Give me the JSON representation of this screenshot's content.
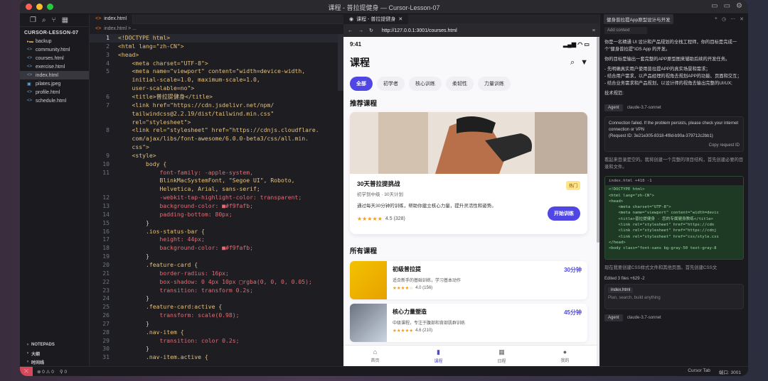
{
  "window": {
    "title": "课程 - 普拉提健身 — Cursor-Lesson-07"
  },
  "sidebar": {
    "project": "CURSOR-LESSON-07",
    "items": [
      {
        "label": "backup",
        "icon": "folder-icon"
      },
      {
        "label": "community.html",
        "icon": "html-file-icon"
      },
      {
        "label": "courses.html",
        "icon": "html-file-icon"
      },
      {
        "label": "exercise.html",
        "icon": "html-file-icon"
      },
      {
        "label": "index.html",
        "icon": "html-file-icon",
        "active": true
      },
      {
        "label": "pilates.jpeg",
        "icon": "image-file-icon"
      },
      {
        "label": "profile.html",
        "icon": "html-file-icon"
      },
      {
        "label": "schedule.html",
        "icon": "html-file-icon"
      }
    ],
    "bottom": [
      "NOTEPADS",
      "大纲",
      "时间线"
    ]
  },
  "editor": {
    "tab": "index.html",
    "breadcrumb": "index.html > ...",
    "lines": [
      {
        "n": "1",
        "t": "<!DOCTYPE html>"
      },
      {
        "n": "2",
        "t": "<html lang=\"zh-CN\">"
      },
      {
        "n": "3",
        "t": "<head>"
      },
      {
        "n": "4",
        "t": "    <meta charset=\"UTF-8\">"
      },
      {
        "n": "5",
        "t": "    <meta name=\"viewport\" content=\"width=device-width,"
      },
      {
        "n": "",
        "t": "    initial-scale=1.0, maximum-scale=1.0,"
      },
      {
        "n": "",
        "t": "    user-scalable=no\">"
      },
      {
        "n": "6",
        "t": "    <title>普拉提健身</title>"
      },
      {
        "n": "7",
        "t": "    <link href=\"https://cdn.jsdelivr.net/npm/"
      },
      {
        "n": "",
        "t": "    tailwindcss@2.2.19/dist/tailwind.min.css\""
      },
      {
        "n": "",
        "t": "    rel=\"stylesheet\">"
      },
      {
        "n": "8",
        "t": "    <link rel=\"stylesheet\" href=\"https://cdnjs.cloudflare."
      },
      {
        "n": "",
        "t": "    com/ajax/libs/font-awesome/6.0.0-beta3/css/all.min."
      },
      {
        "n": "",
        "t": "    css\">"
      },
      {
        "n": "9",
        "t": "    <style>"
      },
      {
        "n": "10",
        "t": "        body {"
      },
      {
        "n": "11",
        "t": "            font-family: -apple-system,"
      },
      {
        "n": "",
        "t": "            BlinkMacSystemFont, \"Segoe UI\", Roboto,"
      },
      {
        "n": "",
        "t": "            Helvetica, Arial, sans-serif;"
      },
      {
        "n": "12",
        "t": "            -webkit-tap-highlight-color: transparent;"
      },
      {
        "n": "13",
        "t": "            background-color: ■#f9fafb;"
      },
      {
        "n": "14",
        "t": "            padding-bottom: 80px;"
      },
      {
        "n": "15",
        "t": "        }"
      },
      {
        "n": "16",
        "t": "        .ios-status-bar {"
      },
      {
        "n": "17",
        "t": "            height: 44px;"
      },
      {
        "n": "18",
        "t": "            background-color: ■#f9fafb;"
      },
      {
        "n": "19",
        "t": "        }"
      },
      {
        "n": "20",
        "t": "        .feature-card {"
      },
      {
        "n": "21",
        "t": "            border-radius: 16px;"
      },
      {
        "n": "22",
        "t": "            box-shadow: 0 4px 10px □rgba(0, 0, 0, 0.05);"
      },
      {
        "n": "23",
        "t": "            transition: transform 0.2s;"
      },
      {
        "n": "24",
        "t": "        }"
      },
      {
        "n": "25",
        "t": "        .feature-card:active {"
      },
      {
        "n": "26",
        "t": "            transform: scale(0.98);"
      },
      {
        "n": "27",
        "t": "        }"
      },
      {
        "n": "28",
        "t": "        .nav-item {"
      },
      {
        "n": "29",
        "t": "            transition: color 0.2s;"
      },
      {
        "n": "30",
        "t": "        }"
      },
      {
        "n": "31",
        "t": "        .nav-item.active {"
      }
    ]
  },
  "browser": {
    "tab": "课程 - 普拉提健身",
    "url": "http://127.0.0.1:3001/courses.html"
  },
  "phone": {
    "time": "9:41",
    "title": "课程",
    "chips": [
      "全部",
      "初学者",
      "核心训练",
      "柔韧性",
      "力量训练"
    ],
    "recommend_title": "推荐课程",
    "feature": {
      "title": "30天普拉提挑战",
      "sub": "初学到中级 · 30天计划",
      "desc": "通过每天30分钟的训练，帮助你建立核心力量，提升灵活性和姿势。",
      "badge": "热门",
      "stars": "★★★★★",
      "rating": "4.5 (328)",
      "button": "开始训练"
    },
    "all_title": "所有课程",
    "courses": [
      {
        "title": "初级普拉提",
        "desc": "适合新手的基础训练，学习基本动作",
        "stars": "★★★★☆",
        "rating": "4.0 (156)",
        "minutes": "30分钟"
      },
      {
        "title": "核心力量塑造",
        "desc": "中级课程，专注于腹部和背部肌群训练",
        "stars": "★★★★★",
        "rating": "4.6 (210)",
        "minutes": "45分钟"
      }
    ],
    "nav": [
      {
        "label": "首页",
        "icon": "home-icon"
      },
      {
        "label": "课程",
        "icon": "book-icon",
        "active": true
      },
      {
        "label": "日程",
        "icon": "calendar-icon"
      },
      {
        "label": "我的",
        "icon": "user-icon"
      }
    ]
  },
  "chat": {
    "tab": "健身普拉提App原型设计与开发",
    "add_context": "Add context",
    "prompt_1": "你是一名精通 UI 设计和产品规划的全栈工程师，你的目标是完成一个\"健身普拉提\"iOS App 的开发。",
    "prompt_2": "你的目标是输出一套完整的APP原型图来辅助后续的开发任务。",
    "prompt_3": "- 先明确真实用户使用普拉提APP的真实场景和需求；",
    "prompt_4": "- 结合用户需求，以产品经理的视角去规划APP的功能、页面和交互；",
    "prompt_5": "- 结合业务需求和产品规划，以设计师的视角去输出完整的UI/UX;",
    "prompt_6": "技术规范:",
    "agent": "Agent",
    "model": "claude-3.7-sonnet",
    "error_1": "Connection failed. If the problem persists, please check your internet connection or VPN",
    "error_2": "(Request ID: 3e21e305-8318-4f8d-b90a-379712c2bb1)",
    "copy": "Copy request ID",
    "reply_1": "看起来目录是空的。我将创建一个完整的项目结构，首先创建必要的目录和文件。",
    "code_header": "index.html +418 -1",
    "code_lines": "<!DOCTYPE html>\n<html lang=\"zh-CN\">\n<head>\n    <meta charset=\"UTF-8\">\n    <meta name=\"viewport\" content=\"width=devic\n    <title>普拉提健身 - 您的专属健身教练</title>\n    <link rel=\"stylesheet\" href=\"https://cdn\n    <link rel=\"stylesheet\" href=\"https://cdnj\n    <link rel=\"stylesheet\" href=\"css/style.css\n</head>\n<body class=\"font-sans bg-gray-50 text-gray-8",
    "reply_2": "现在我要创建CSS样式文件和其他页面。首先创建CSS文",
    "edited": "Edited 3 files +629 -2",
    "file_ref": "index.html",
    "input_placeholder": "Plan, search, build anything"
  },
  "statusbar": {
    "left": [
      "⊗ 0 ⚠ 0",
      "⚲ 0"
    ],
    "right": [
      "Cursor Tab",
      "端口: 3001"
    ]
  }
}
